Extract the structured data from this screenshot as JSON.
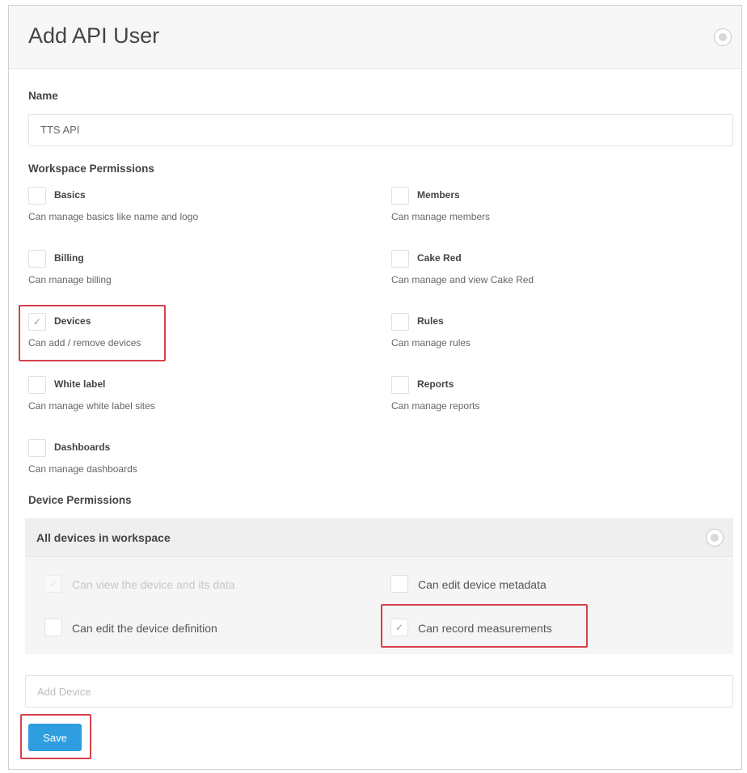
{
  "dialog": {
    "title": "Add API User",
    "close_icon": "close-circle-icon"
  },
  "name_field": {
    "label": "Name",
    "value": "TTS API"
  },
  "workspace_permissions": {
    "label": "Workspace Permissions",
    "items": [
      {
        "title": "Basics",
        "description": "Can manage basics like name and logo",
        "checked": false
      },
      {
        "title": "Members",
        "description": "Can manage members",
        "checked": false
      },
      {
        "title": "Billing",
        "description": "Can manage billing",
        "checked": false
      },
      {
        "title": "Cake Red",
        "description": "Can manage and view Cake Red",
        "checked": false
      },
      {
        "title": "Devices",
        "description": "Can add / remove devices",
        "checked": true
      },
      {
        "title": "Rules",
        "description": "Can manage rules",
        "checked": false
      },
      {
        "title": "White label",
        "description": "Can manage white label sites",
        "checked": false
      },
      {
        "title": "Reports",
        "description": "Can manage reports",
        "checked": false
      },
      {
        "title": "Dashboards",
        "description": "Can manage dashboards",
        "checked": false
      }
    ]
  },
  "device_permissions": {
    "label": "Device Permissions",
    "panel_title": "All devices in workspace",
    "items": [
      {
        "label": "Can view the device and its data",
        "checked": true,
        "disabled": true
      },
      {
        "label": "Can edit device metadata",
        "checked": false,
        "disabled": false
      },
      {
        "label": "Can edit the device definition",
        "checked": false,
        "disabled": false
      },
      {
        "label": "Can record measurements",
        "checked": true,
        "disabled": false
      }
    ]
  },
  "add_device": {
    "placeholder": "Add Device"
  },
  "save_button": {
    "label": "Save"
  },
  "colors": {
    "primary": "#2e9ee0",
    "highlight": "#d6404b"
  }
}
